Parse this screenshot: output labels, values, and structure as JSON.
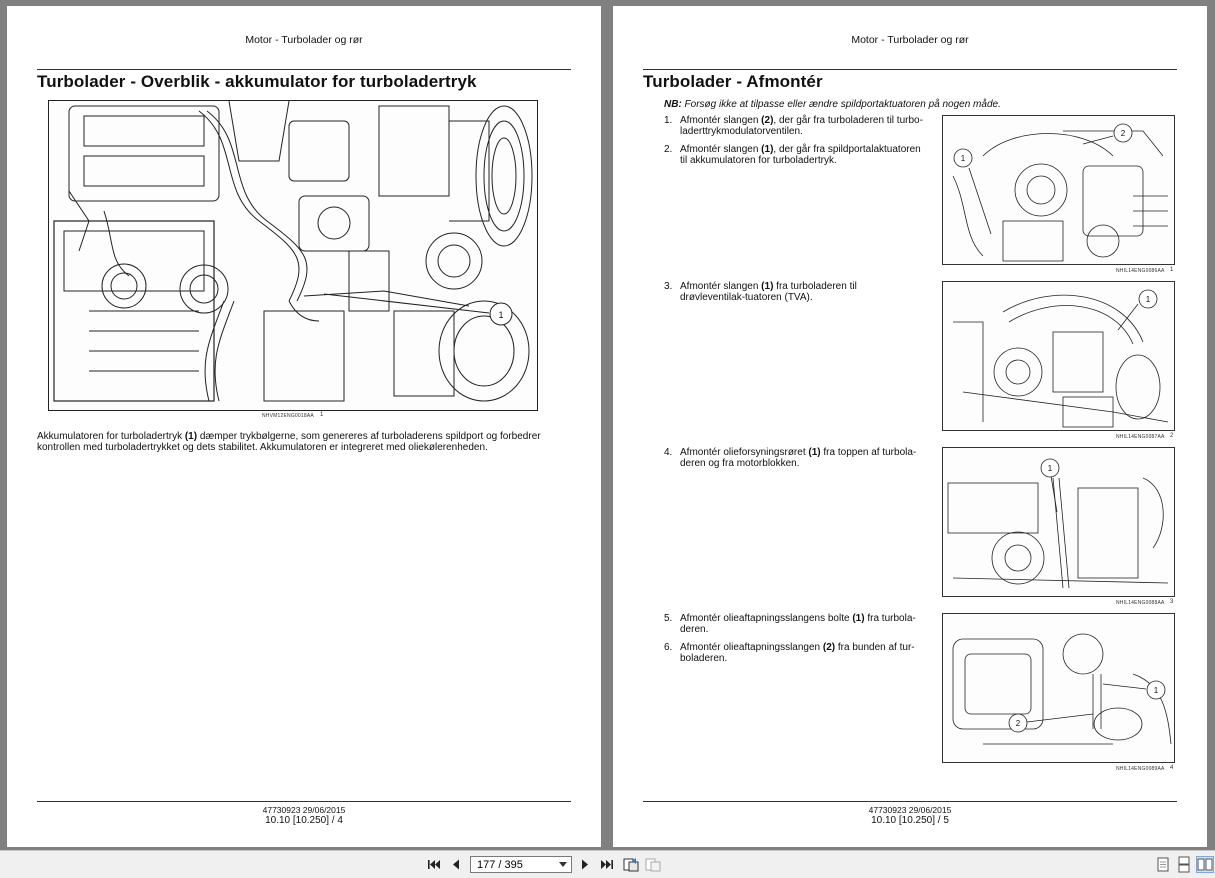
{
  "left_page": {
    "running_head": "Motor - Turbolader og rør",
    "title": "Turbolader - Overblik - akkumulator for turboladertryk",
    "figure": {
      "code": "NHVM12ENG0018AA",
      "number": "1",
      "callout": "1"
    },
    "paragraph_parts": [
      "Akkumulatoren for turboladertryk ",
      "(1)",
      " dæmper trykbølgerne, som genereres af turboladerens spildport og forbedrer kontrollen med turboladertrykket og dets stabilitet. Akkumulatoren er integreret med oliekølerenheden."
    ],
    "footer": {
      "doc": "47730923 29/06/2015",
      "page": "10.10 [10.250] / 4"
    }
  },
  "right_page": {
    "running_head": "Motor - Turbolader og rør",
    "title": "Turbolader - Afmontér",
    "note": {
      "label": "NB:",
      "text": " Forsøg ikke at tilpasse eller ændre spildportaktuatoren på nogen måde."
    },
    "steps": [
      {
        "num": "1.",
        "a": "Afmontér slangen ",
        "b": "(2)",
        "c": ", der går fra turboladeren til turbo-laderttrykmodulatorventilen."
      },
      {
        "num": "2.",
        "a": "Afmontér slangen ",
        "b": "(1)",
        "c": ", der går fra spildportalaktuatoren til akkumulatoren for turboladertryk."
      },
      {
        "num": "3.",
        "a": "Afmontér slangen ",
        "b": "(1)",
        "c": " fra turboladeren til drøvleventilak-tuatoren (TVA)."
      },
      {
        "num": "4.",
        "a": "Afmontér olieforsyningsrøret ",
        "b": "(1)",
        "c": " fra toppen af turbola-deren og fra motorblokken."
      },
      {
        "num": "5.",
        "a": "Afmontér olieaftapningsslangens bolte ",
        "b": "(1)",
        "c": " fra turbola-deren."
      },
      {
        "num": "6.",
        "a": "Afmontér olieaftapningsslangen ",
        "b": "(2)",
        "c": " fra bunden af tur-boladeren."
      }
    ],
    "figures": [
      {
        "code": "NHIL14ENG0086AA",
        "number": "1",
        "callouts": [
          "1",
          "2"
        ]
      },
      {
        "code": "NHIL14ENG0087AA",
        "number": "2",
        "callouts": [
          "1"
        ]
      },
      {
        "code": "NHIL14ENG0088AA",
        "number": "3",
        "callouts": [
          "1"
        ]
      },
      {
        "code": "NHIL14ENG0089AA",
        "number": "4",
        "callouts": [
          "1",
          "2"
        ]
      }
    ],
    "footer": {
      "doc": "47730923 29/06/2015",
      "page": "10.10 [10.250] / 5"
    }
  },
  "toolbar": {
    "page_value": "177 / 395",
    "icons": [
      "first-page-icon",
      "previous-page-icon",
      "next-page-icon",
      "last-page-icon",
      "previous-view-icon",
      "next-view-icon",
      "single-page-view-icon",
      "continuous-view-icon",
      "two-page-view-icon"
    ]
  },
  "colors": {
    "background": "#808080",
    "page": "#ffffff",
    "toolbar": "#f0f0f0",
    "ink": "#111111"
  }
}
